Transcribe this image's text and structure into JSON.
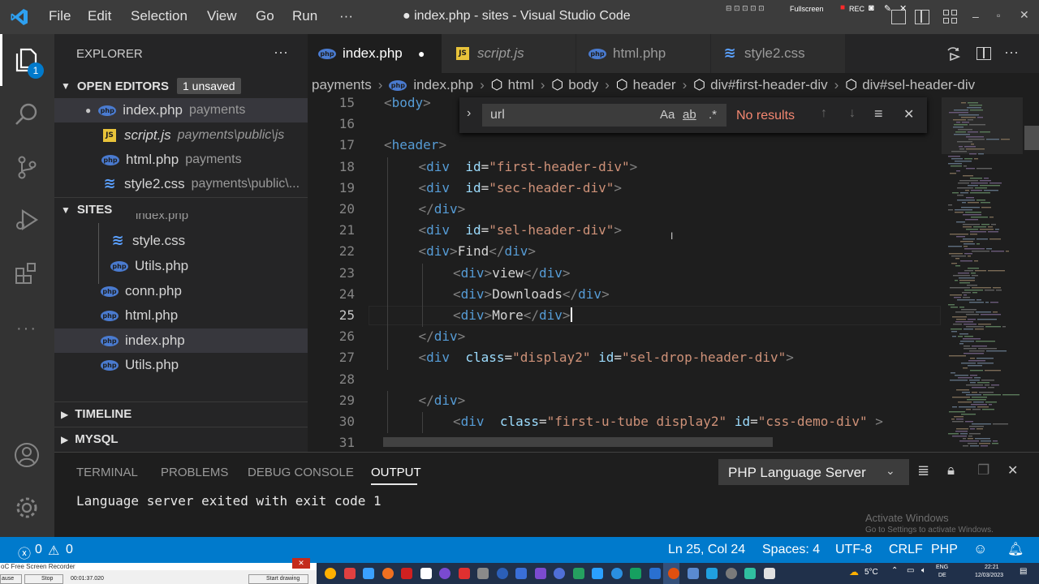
{
  "titlebar": {
    "menu": [
      "File",
      "Edit",
      "Selection",
      "View",
      "Go",
      "Run",
      "···"
    ],
    "title": "● index.php - sites - Visual Studio Code",
    "recorder": {
      "fullscreen": "Fullscreen",
      "rec": "REC"
    }
  },
  "sidebar": {
    "explorer_title": "EXPLORER",
    "explorer_more": "···",
    "open_editors": {
      "label": "OPEN EDITORS",
      "badge": "1 unsaved"
    },
    "open_files": [
      {
        "name": "index.php",
        "path": "payments",
        "icon": "php-icon",
        "dirty": true
      },
      {
        "name": "script.js",
        "path": "payments\\public\\js",
        "icon": "js-icon",
        "italic": true
      },
      {
        "name": "html.php",
        "path": "payments",
        "icon": "php-icon"
      },
      {
        "name": "style2.css",
        "path": "payments\\public\\...",
        "icon": "css-icon"
      }
    ],
    "sites_label": "SITES",
    "sites_partial": "index.php",
    "site_files": [
      {
        "name": "style.css",
        "icon": "css-icon"
      },
      {
        "name": "Utils.php",
        "icon": "php-icon"
      },
      {
        "name": "conn.php",
        "icon": "php-icon"
      },
      {
        "name": "html.php",
        "icon": "php-icon"
      },
      {
        "name": "index.php",
        "icon": "php-icon"
      },
      {
        "name": "Utils.php",
        "icon": "php-icon"
      }
    ],
    "timeline": "TIMELINE",
    "mysql": "MYSQL"
  },
  "tabs": [
    {
      "label": "index.php",
      "active": true,
      "dirty_mark": "●"
    },
    {
      "label": "script.js"
    },
    {
      "label": "html.php"
    },
    {
      "label": "style2.css"
    }
  ],
  "breadcrumb": [
    "payments",
    "index.php",
    "html",
    "body",
    "header",
    "div#first-header-div",
    "div#sel-header-div"
  ],
  "find": {
    "value": "url",
    "opt_case": "Aa",
    "opt_word": "ab",
    "opt_regex": ".*",
    "result": "No results"
  },
  "editor": {
    "current_line": "25",
    "cursor_marker": "I",
    "lines": [
      {
        "n": "15",
        "parts": [
          [
            "tg",
            "<"
          ],
          [
            "tn",
            "body"
          ],
          [
            "tg",
            ">"
          ]
        ],
        "indent": 0
      },
      {
        "n": "16",
        "parts": [],
        "indent": 0
      },
      {
        "n": "17",
        "parts": [
          [
            "tg",
            "<"
          ],
          [
            "tn",
            "header"
          ],
          [
            "tg",
            ">"
          ]
        ],
        "indent": 0
      },
      {
        "n": "18",
        "parts": [
          [
            "tg",
            "<"
          ],
          [
            "tn",
            "div"
          ],
          [
            "tx",
            "  "
          ],
          [
            "at",
            "id"
          ],
          [
            "tx",
            "="
          ],
          [
            "st",
            "\"first-header-div\""
          ],
          [
            "tg",
            ">"
          ]
        ],
        "indent": 1
      },
      {
        "n": "19",
        "parts": [
          [
            "tg",
            "<"
          ],
          [
            "tn",
            "div"
          ],
          [
            "tx",
            "  "
          ],
          [
            "at",
            "id"
          ],
          [
            "tx",
            "="
          ],
          [
            "st",
            "\"sec-header-div\""
          ],
          [
            "tg",
            ">"
          ]
        ],
        "indent": 1
      },
      {
        "n": "20",
        "parts": [
          [
            "tg",
            "</"
          ],
          [
            "tn",
            "div"
          ],
          [
            "tg",
            ">"
          ]
        ],
        "indent": 1
      },
      {
        "n": "21",
        "parts": [
          [
            "tg",
            "<"
          ],
          [
            "tn",
            "div"
          ],
          [
            "tx",
            "  "
          ],
          [
            "at",
            "id"
          ],
          [
            "tx",
            "="
          ],
          [
            "st",
            "\"sel-header-div\""
          ],
          [
            "tg",
            ">"
          ]
        ],
        "indent": 1
      },
      {
        "n": "22",
        "parts": [
          [
            "tg",
            "<"
          ],
          [
            "tn",
            "div"
          ],
          [
            "tg",
            ">"
          ],
          [
            "tx",
            "Find"
          ],
          [
            "tg",
            "</"
          ],
          [
            "tn",
            "div"
          ],
          [
            "tg",
            ">"
          ]
        ],
        "indent": 1
      },
      {
        "n": "23",
        "parts": [
          [
            "tg",
            "<"
          ],
          [
            "tn",
            "div"
          ],
          [
            "tg",
            ">"
          ],
          [
            "tx",
            "view"
          ],
          [
            "tg",
            "</"
          ],
          [
            "tn",
            "div"
          ],
          [
            "tg",
            ">"
          ]
        ],
        "indent": 2
      },
      {
        "n": "24",
        "parts": [
          [
            "tg",
            "<"
          ],
          [
            "tn",
            "div"
          ],
          [
            "tg",
            ">"
          ],
          [
            "tx",
            "Downloads"
          ],
          [
            "tg",
            "</"
          ],
          [
            "tn",
            "div"
          ],
          [
            "tg",
            ">"
          ]
        ],
        "indent": 2
      },
      {
        "n": "25",
        "parts": [
          [
            "tg",
            "<"
          ],
          [
            "tn",
            "div"
          ],
          [
            "tg",
            ">"
          ],
          [
            "tx",
            "More"
          ],
          [
            "tg",
            "</"
          ],
          [
            "tn",
            "div"
          ],
          [
            "tg",
            ">"
          ]
        ],
        "indent": 2
      },
      {
        "n": "26",
        "parts": [
          [
            "tg",
            "</"
          ],
          [
            "tn",
            "div"
          ],
          [
            "tg",
            ">"
          ]
        ],
        "indent": 1
      },
      {
        "n": "27",
        "parts": [
          [
            "tg",
            "<"
          ],
          [
            "tn",
            "div"
          ],
          [
            "tx",
            "  "
          ],
          [
            "at",
            "class"
          ],
          [
            "tx",
            "="
          ],
          [
            "st",
            "\"display2\""
          ],
          [
            "tx",
            " "
          ],
          [
            "at",
            "id"
          ],
          [
            "tx",
            "="
          ],
          [
            "st",
            "\"sel-drop-header-div\""
          ],
          [
            "tg",
            ">"
          ]
        ],
        "indent": 1
      },
      {
        "n": "28",
        "parts": [],
        "indent": 0
      },
      {
        "n": "29",
        "parts": [
          [
            "tg",
            "</"
          ],
          [
            "tn",
            "div"
          ],
          [
            "tg",
            ">"
          ]
        ],
        "indent": 1
      },
      {
        "n": "30",
        "parts": [
          [
            "tg",
            "<"
          ],
          [
            "tn",
            "div"
          ],
          [
            "tx",
            "  "
          ],
          [
            "at",
            "class"
          ],
          [
            "tx",
            "="
          ],
          [
            "st",
            "\"first-u-tube display2\""
          ],
          [
            "tx",
            " "
          ],
          [
            "at",
            "id"
          ],
          [
            "tx",
            "="
          ],
          [
            "st",
            "\"css-demo-div\""
          ],
          [
            "tx",
            " "
          ],
          [
            "tg",
            ">"
          ]
        ],
        "indent": 2
      },
      {
        "n": "31",
        "parts": [],
        "indent": 0
      }
    ]
  },
  "panel": {
    "tabs": [
      "TERMINAL",
      "PROBLEMS",
      "DEBUG CONSOLE",
      "OUTPUT"
    ],
    "active_tab": "OUTPUT",
    "channel": "PHP Language Server",
    "output": "Language server exited with exit code 1",
    "watermark_title": "Activate Windows",
    "watermark_sub": "Go to Settings to activate Windows."
  },
  "statusbar": {
    "errors": "0",
    "warnings": "0",
    "position": "Ln 25, Col 24",
    "spaces": "Spaces: 4",
    "encoding": "UTF-8",
    "eol": "CRLF",
    "language": "PHP"
  },
  "taskbar": {
    "recorder_title": "oC Free Screen Recorder",
    "pause": "ause",
    "stop": "Stop",
    "timer": "00:01:37.020",
    "start_drawing": "Start drawing",
    "temp": "5°C",
    "lang": "ENG",
    "region": "DE",
    "time": "22:21",
    "date": "12/03/2023"
  },
  "colors": {
    "accent": "#007acc",
    "titlebar": "#3c3c3c",
    "sidebar": "#252526",
    "editor": "#1e1e1e"
  }
}
